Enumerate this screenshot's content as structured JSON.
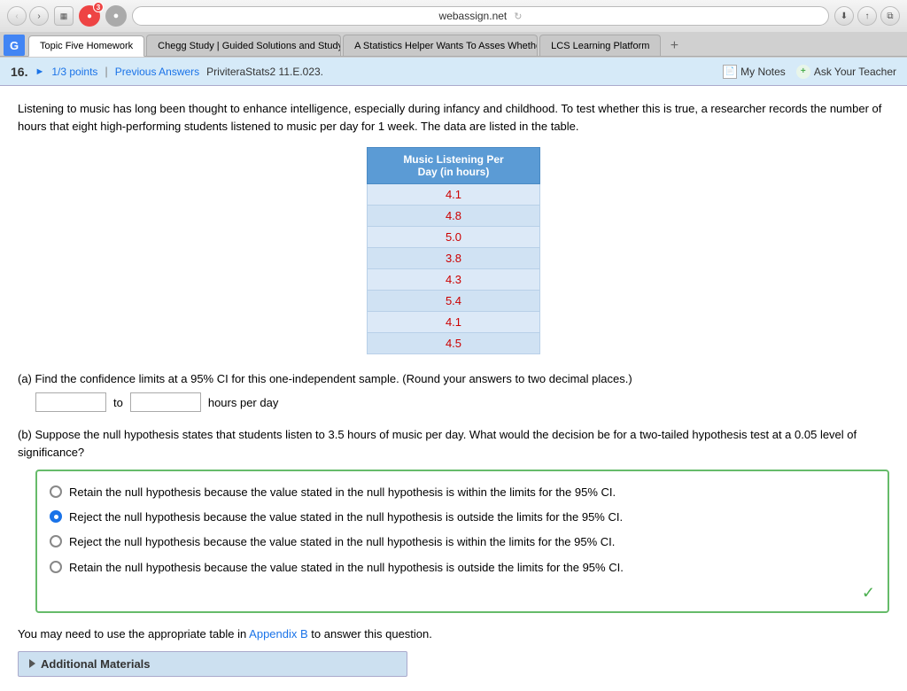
{
  "browser": {
    "url": "webassign.net",
    "tabs": [
      {
        "label": "Topic Five Homework",
        "active": true
      },
      {
        "label": "Chegg Study | Guided Solutions and Study Help |...",
        "active": false
      },
      {
        "label": "A Statistics Helper Wants To Asses Whether Her...",
        "active": false
      },
      {
        "label": "LCS Learning Platform",
        "active": false
      }
    ],
    "tab_add": "+"
  },
  "question_header": {
    "number": "16.",
    "points_label": "1/3 points",
    "separator": "|",
    "prev_answers": "Previous Answers",
    "ref": "PriviteraStats2 11.E.023.",
    "notes_label": "My Notes",
    "ask_teacher_label": "Ask Your Teacher"
  },
  "content": {
    "intro_text": "Listening to music has long been thought to enhance intelligence, especially during infancy and childhood. To test whether this is true, a researcher records the number of hours that eight high-performing students listened to music per day for 1 week. The data are listed in the table.",
    "table": {
      "header": "Music Listening Per Day (in hours)",
      "values": [
        "4.1",
        "4.8",
        "5.0",
        "3.8",
        "4.3",
        "5.4",
        "4.1",
        "4.5"
      ]
    },
    "part_a": {
      "label": "(a) Find the confidence limits at a 95% CI for this one-independent sample. (Round your answers to two decimal places.)",
      "input1_value": "",
      "to_label": "to",
      "input2_value": "",
      "unit_label": "hours per day"
    },
    "part_b": {
      "label": "(b) Suppose the null hypothesis states that students listen to 3.5 hours of music per day. What would the decision be for a two-tailed hypothesis test at a 0.05 level of significance?",
      "options": [
        {
          "id": "opt1",
          "text": "Retain the null hypothesis because the value stated in the null hypothesis is within the limits for the 95% CI.",
          "selected": false
        },
        {
          "id": "opt2",
          "text": "Reject the null hypothesis because the value stated in the null hypothesis is outside the limits for the 95% CI.",
          "selected": true
        },
        {
          "id": "opt3",
          "text": "Reject the null hypothesis because the value stated in the null hypothesis is within the limits for the 95% CI.",
          "selected": false
        },
        {
          "id": "opt4",
          "text": "Retain the null hypothesis because the value stated in the null hypothesis is outside the limits for the 95% CI.",
          "selected": false
        }
      ]
    },
    "footer_note": "You may need to use the appropriate table in",
    "appendix_link": "Appendix B",
    "footer_note2": "to answer this question.",
    "additional_materials_label": "Additional Materials"
  }
}
